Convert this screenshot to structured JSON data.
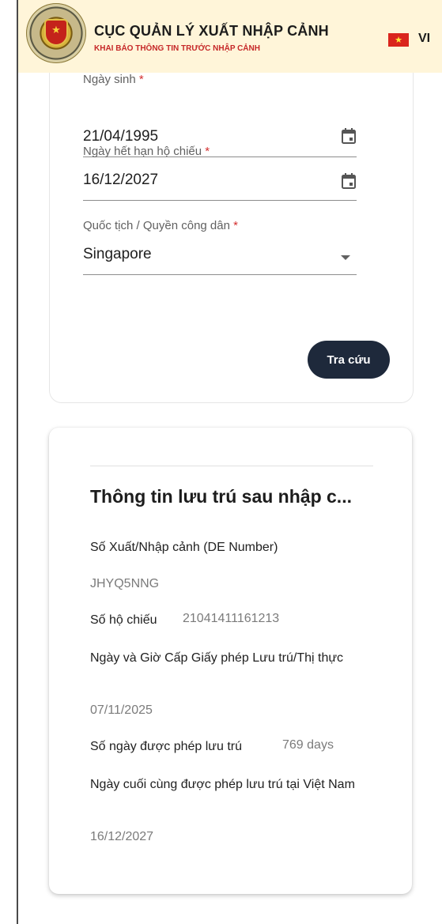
{
  "header": {
    "title": "CỤC QUẢN LÝ XUẤT NHẬP CẢNH",
    "subtitle": "KHAI BÁO THÔNG TIN TRƯỚC NHẬP CẢNH",
    "language": "VI",
    "flag_icon": "vietnam-flag-icon",
    "emblem_icon": "immigration-emblem-icon"
  },
  "form": {
    "birth_date": {
      "label": "Ngày sinh",
      "required": "*",
      "value": "21/04/1995"
    },
    "passport_expiry": {
      "label": "Ngày hết hạn hộ chiếu",
      "required": "*",
      "value": "16/12/2027"
    },
    "nationality": {
      "label": "Quốc tịch / Quyền công dân",
      "required": "*",
      "value": "Singapore"
    },
    "search_button": "Tra cứu"
  },
  "residence_info": {
    "title": "Thông tin lưu trú sau nhập c...",
    "de_number_label": "Số Xuất/Nhập cảnh (DE Number)",
    "de_number_value": "JHYQ5NNG",
    "passport_label": "Số hộ chiếu",
    "passport_value": "21041411161213",
    "permit_date_label": "Ngày và Giờ Cấp Giấy phép Lưu trú/Thị thực",
    "permit_date_value": "07/11/2025",
    "allowed_days_label": "Số ngày được phép lưu trú",
    "allowed_days_value": "769 days",
    "last_day_label": "Ngày cuối cùng được phép lưu trú tại Việt Nam",
    "last_day_value": "16/12/2027"
  },
  "colors": {
    "header_bg": "#fff5d9",
    "accent_red": "#c62828",
    "button_bg": "#1e293b"
  }
}
